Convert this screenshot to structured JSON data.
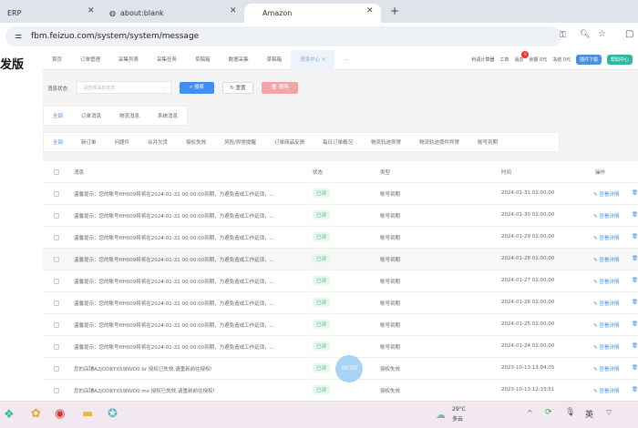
{
  "browser": {
    "tabs": [
      {
        "title": "ERP"
      },
      {
        "title": "about:blank"
      },
      {
        "title": "Amazon"
      }
    ],
    "url": "fbm.feizuo.com/system/system/message"
  },
  "sidebar": {
    "logo": "发版"
  },
  "topnav": {
    "items": [
      "首页",
      "订单管理",
      "采集列表",
      "采集任务",
      "草稿箱",
      "数据采集",
      "草稿箱",
      "消息中心",
      "···"
    ],
    "right": [
      "利润计算器",
      "工单",
      "消息",
      "余额 0元",
      "冻结 0元"
    ],
    "badge": "9",
    "download_btn": "插件下载",
    "help_btn": "帮助中心"
  },
  "filter": {
    "label": "消息状态",
    "placeholder": "请选择消息状态",
    "search": "搜索",
    "reset": "重置",
    "delete": "删除"
  },
  "tabs1": [
    "全部",
    "订单消息",
    "物流消息",
    "系统消息"
  ],
  "tabs2": [
    "全部",
    "新订单",
    "问题件",
    "合并欠货",
    "授权失效",
    "风险/异常提醒",
    "订单商品反馈",
    "每日订单概况",
    "物流轨迹异常",
    "物流轨迹揽件异常",
    "账号到期"
  ],
  "table": {
    "headers": [
      "消息",
      "状态",
      "类型",
      "时间",
      "操作"
    ],
    "action": "查看详情",
    "rows": [
      {
        "msg": "温馨提示：您的账号HH009将将在2024-01-31 00:00:00到期，为避免造成工作延误，...",
        "status": "已读",
        "type": "账号到期",
        "time": "2024-01-31 01:00:00"
      },
      {
        "msg": "温馨提示：您的账号HH009将将在2024-01-31 00:00:00到期，为避免造成工作延误，...",
        "status": "已读",
        "type": "账号到期",
        "time": "2024-01-30 01:00:00"
      },
      {
        "msg": "温馨提示：您的账号HH009将将在2024-01-31 00:00:00到期，为避免造成工作延误，...",
        "status": "已读",
        "type": "账号到期",
        "time": "2024-01-29 01:00:00"
      },
      {
        "msg": "温馨提示：您的账号HH009将将在2024-01-31 00:00:00到期，为避免造成工作延误，...",
        "status": "已读",
        "type": "账号到期",
        "time": "2024-01-28 01:00:00"
      },
      {
        "msg": "温馨提示：您的账号HH009将将在2024-01-31 00:00:00到期，为避免造成工作延误，...",
        "status": "已读",
        "type": "账号到期",
        "time": "2024-01-27 01:00:00"
      },
      {
        "msg": "温馨提示：您的账号HH009将将在2024-01-31 00:00:00到期，为避免造成工作延误，...",
        "status": "已读",
        "type": "账号到期",
        "time": "2024-01-26 01:00:00"
      },
      {
        "msg": "温馨提示：您的账号HH009将将在2024-01-31 00:00:00到期，为避免造成工作延误，...",
        "status": "已读",
        "type": "账号到期",
        "time": "2024-01-25 01:00:00"
      },
      {
        "msg": "温馨提示：您的账号HH009将将在2024-01-31 00:00:00到期，为避免造成工作延误，...",
        "status": "已读",
        "type": "账号到期",
        "time": "2024-01-24 01:00:00"
      },
      {
        "msg": "您的店铺A2JODKYX59NVD0 br 授权已失效,请重新前往授权!",
        "status": "已读",
        "type": "授权失效",
        "time": "2023-10-13 13:04:05"
      },
      {
        "msg": "您的店铺A2JODKYX59NVD0 mx 授权已失效,请重新前往授权!",
        "status": "已读",
        "type": "授权失效",
        "time": "2023-10-13 12:33:51"
      }
    ]
  },
  "recording": "00:00",
  "taskbar": {
    "temp": "29°C",
    "weather": "多云",
    "ime": "英"
  }
}
